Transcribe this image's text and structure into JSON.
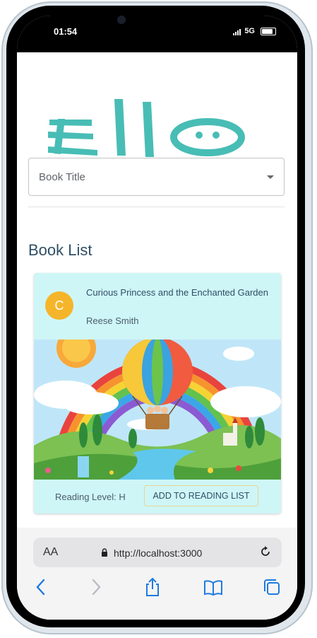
{
  "status_bar": {
    "time": "01:54",
    "network": "5G"
  },
  "app": {
    "logo_text": "Ello"
  },
  "filter": {
    "book_title_label": "Book Title"
  },
  "section": {
    "title": "Book List"
  },
  "book": {
    "avatar_letter": "C",
    "title": "Curious Princess and the Enchanted Garden",
    "author": "Reese Smith",
    "reading_level": "Reading Level: H",
    "add_button": "ADD TO READING LIST"
  },
  "browser": {
    "text_size_label": "AA",
    "url": "http://localhost:3000"
  },
  "colors": {
    "brand_teal": "#48bdb5",
    "avatar": "#f5b52a",
    "card_bg": "#cef6f7",
    "accent": "#1f7ae0"
  }
}
